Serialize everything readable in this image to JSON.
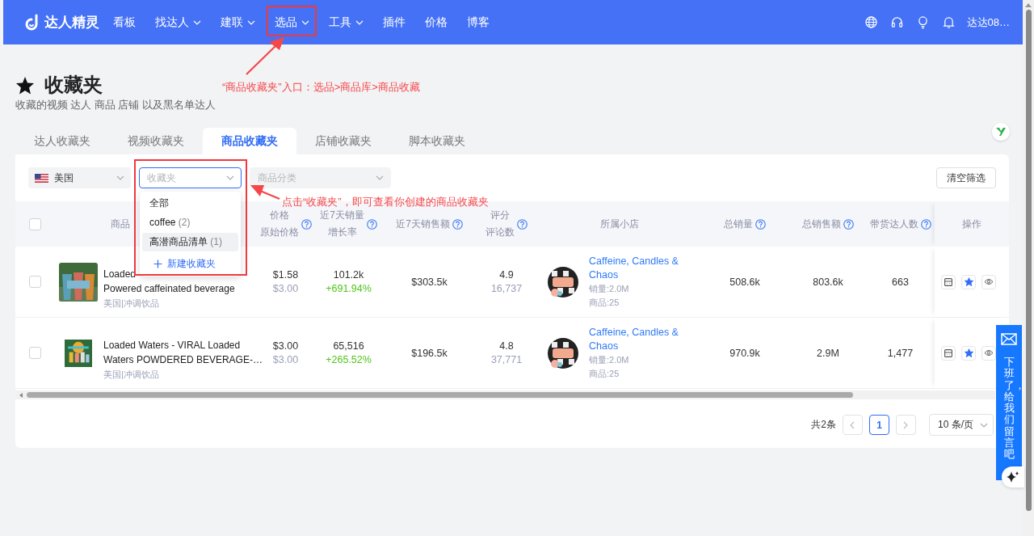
{
  "nav": {
    "logo": "达人精灵",
    "items": [
      {
        "label": "看板",
        "caret": false
      },
      {
        "label": "找达人",
        "caret": true
      },
      {
        "label": "建联",
        "caret": true
      },
      {
        "label": "选品",
        "caret": true
      },
      {
        "label": "工具",
        "caret": true
      },
      {
        "label": "插件",
        "caret": false
      },
      {
        "label": "价格",
        "caret": false
      },
      {
        "label": "博客",
        "caret": false
      }
    ],
    "user": "达达08…"
  },
  "page": {
    "title": "收藏夹",
    "subtitle": "收藏的视频 达人 商品 店铺 以及黑名单达人"
  },
  "tabs": [
    {
      "label": "达人收藏夹",
      "selected": false
    },
    {
      "label": "视频收藏夹",
      "selected": false
    },
    {
      "label": "商品收藏夹",
      "selected": true
    },
    {
      "label": "店铺收藏夹",
      "selected": false
    },
    {
      "label": "脚本收藏夹",
      "selected": false
    }
  ],
  "filters": {
    "country": {
      "value": "美国"
    },
    "folder": {
      "placeholder": "收藏夹",
      "open": true
    },
    "category": {
      "placeholder": "商品分类"
    },
    "clear_button": "清空筛选"
  },
  "folder_menu": {
    "items": [
      {
        "label": "全部",
        "hovered": false
      },
      {
        "label": "coffee",
        "count": "(2)",
        "hovered": false
      },
      {
        "label": "高潜商品清单",
        "count": "(1)",
        "hovered": true
      }
    ],
    "new_folder": "新建收藏夹"
  },
  "table": {
    "select_all_checked": false,
    "columns": [
      {
        "lines": [
          "商品"
        ],
        "help": false
      },
      {
        "lines": [
          "价格",
          "原始价格"
        ],
        "help": true
      },
      {
        "lines": [
          "近7天销量",
          "增长率"
        ],
        "help": true
      },
      {
        "lines": [
          "近7天销售额"
        ],
        "help": true
      },
      {
        "lines": [
          "评分",
          "评论数"
        ],
        "help": true
      },
      {
        "lines": [
          "所属小店"
        ],
        "help": false
      },
      {
        "lines": [
          "总销量"
        ],
        "help": true
      },
      {
        "lines": [
          "总销售额"
        ],
        "help": true
      },
      {
        "lines": [
          "带货达人数"
        ],
        "help": true
      },
      {
        "lines": [
          "操作"
        ],
        "help": false
      }
    ],
    "rows": [
      {
        "checked": false,
        "title_lines": [
          "Loaded",
          "Powered caffeinated beverage"
        ],
        "meta": "美国|冲调饮品",
        "price": "$1.58",
        "original_price": "$3.00",
        "sales_7d": "101.2k",
        "growth": "+691.94%",
        "revenue_7d": "$303.5k",
        "rating": "4.9",
        "reviews": "16,737",
        "shop": "Caffeine, Candles & Chaos",
        "shop_sales": "销量:2.0M",
        "shop_products": "商品:25",
        "total_sales": "508.6k",
        "total_revenue": "803.6k",
        "creators": "663",
        "favorited": true
      },
      {
        "checked": false,
        "title_lines": [
          "Loaded Waters - VIRAL Loaded",
          "Waters POWDERED BEVERAGE-…"
        ],
        "meta": "美国|冲调饮品",
        "price": "$3.00",
        "original_price": "$3.00",
        "sales_7d": "65,516",
        "growth": "+265.52%",
        "revenue_7d": "$196.5k",
        "rating": "4.8",
        "reviews": "37,771",
        "shop": "Caffeine, Candles & Chaos",
        "shop_sales": "销量:2.0M",
        "shop_products": "商品:25",
        "total_sales": "970.9k",
        "total_revenue": "2.9M",
        "creators": "1,477",
        "favorited": true
      }
    ]
  },
  "pagination": {
    "total": "共2条",
    "pages": [
      {
        "label": "1",
        "selected": true
      }
    ],
    "page_size": "10 条/页"
  },
  "feedback": {
    "text": "下班了，给我们留言吧"
  },
  "annotations": [
    {
      "text": "“商品收藏夹”入口：选品>商品库>商品收藏"
    },
    {
      "text": "点击“收藏夹”，即可查看你创建的商品收藏夹"
    }
  ]
}
